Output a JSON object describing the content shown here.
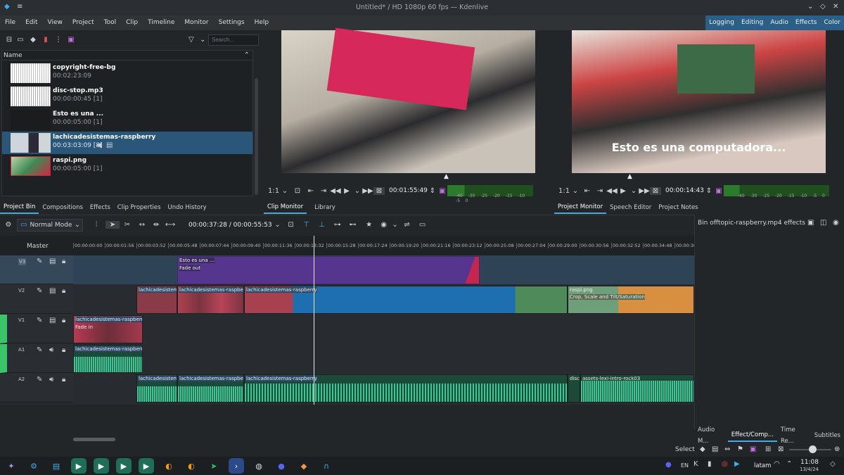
{
  "window": {
    "title": "Untitled* / HD 1080p 60 fps — Kdenlive"
  },
  "menu": [
    "File",
    "Edit",
    "View",
    "Project",
    "Tool",
    "Clip",
    "Timeline",
    "Monitor",
    "Settings",
    "Help"
  ],
  "layouts": [
    "Logging",
    "Editing",
    "Audio",
    "Effects",
    "Color"
  ],
  "bin": {
    "search_placeholder": "Search...",
    "header": "Name",
    "items": [
      {
        "name": "copyright-free-bg",
        "info": "00:02:23:09"
      },
      {
        "name": "disc-stop.mp3",
        "info": "00:00:00:45 [1]"
      },
      {
        "name": "Esto es una ...",
        "info": "00:00:05:00 [1]"
      },
      {
        "name": "lachicadesistemas-raspberry",
        "info": "00:03:03:09 [8]"
      },
      {
        "name": "raspi.png",
        "info": "00:00:05:00 [1]"
      }
    ]
  },
  "left_tabs": [
    "Project Bin",
    "Compositions",
    "Effects",
    "Clip Properties",
    "Undo History"
  ],
  "clip_monitor": {
    "zoom": "1:1",
    "timecode": "00:01:55:49",
    "tabs": [
      "Clip Monitor",
      "Library"
    ],
    "meter": [
      "-40",
      "-30",
      "-25",
      "-20",
      "-15",
      "-10",
      "-5",
      "0"
    ]
  },
  "project_monitor": {
    "zoom": "1:1",
    "timecode": "00:00:14:43",
    "overlay": "Esto es una computadora...",
    "tabs": [
      "Project Monitor",
      "Speech Editor",
      "Project Notes"
    ]
  },
  "timeline": {
    "mode": "Normal Mode",
    "position": "00:00:37:28 / 00:00:55:53",
    "master": "Master",
    "ruler": [
      "00:00:00:00",
      "00:00:01:56",
      "00:00:03:52",
      "00:00:05:48",
      "00:00:07:44",
      "00:00:09:40",
      "00:00:11:36",
      "00:00:13:32",
      "00:00:15:28",
      "00:00:17:24",
      "00:00:19:20",
      "00:00:21:16",
      "00:00:23:12",
      "00:00:25:08",
      "00:00:27:04",
      "00:00:29:00",
      "00:00:30:56",
      "00:00:32:52",
      "00:00:34:48",
      "00:00:36"
    ],
    "tracks": [
      "V3",
      "V2",
      "V1",
      "A1",
      "A2"
    ],
    "clips": {
      "title": "Esto es una ...",
      "fade_out": "Fade out",
      "v2a": "lachicadesistemas",
      "v2b": "lachicadesistemas-raspberry",
      "v2c": "lachicadesistemas-raspberry",
      "raspi": "raspi.png",
      "raspi_fx": "Crop, Scale and Tilt/Saturation",
      "v1": "lachicadesistemas-raspberry",
      "fade_in": "Fade in",
      "a1": "lachicadesistemas-raspberry",
      "a2a": "lachicadesistema",
      "a2b": "lachicadesistemas-raspberry",
      "a2c": "lachicadesistemas-raspberry",
      "disc": "disc",
      "intro": "assets-lexi-intro-rock03"
    }
  },
  "effect_panel": {
    "title": "Bin offtopic-raspberry.mp4 effects",
    "tabs": [
      "Audio M...",
      "Effect/Comp...",
      "Time Re...",
      "Subtitles"
    ]
  },
  "status": {
    "select": "Select"
  },
  "taskbar": {
    "lang": "EN",
    "user": "latam",
    "time": "11:08",
    "date": "13/4/24"
  }
}
